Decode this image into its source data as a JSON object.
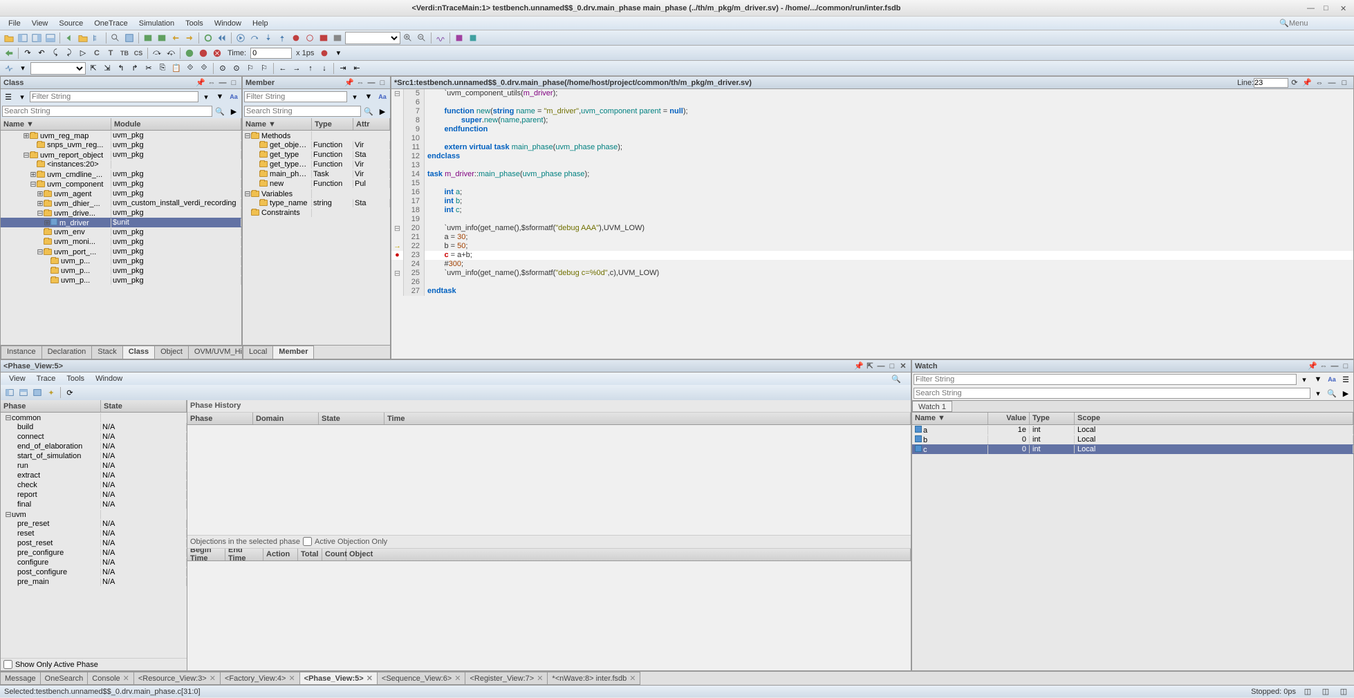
{
  "title": "<Verdi:nTraceMain:1> testbench.unnamed$$_0.drv.main_phase main_phase (../th/m_pkg/m_driver.sv) - /home/.../common/run/inter.fsdb",
  "menubar": [
    "File",
    "View",
    "Source",
    "OneTrace",
    "Simulation",
    "Tools",
    "Window",
    "Help"
  ],
  "menu_search_placeholder": "Menu",
  "toolbar2": {
    "time_label": "Time:",
    "time_value": "0",
    "time_unit": "x 1ps"
  },
  "class_pane": {
    "title": "Class",
    "filter_placeholder": "Filter String",
    "search_placeholder": "Search String",
    "headers": [
      "Name ▼",
      "Module"
    ],
    "rows": [
      {
        "indent": 3,
        "exp": "⊞",
        "icon": "folder",
        "name": "uvm_reg_map",
        "module": "uvm_pkg"
      },
      {
        "indent": 4,
        "exp": "",
        "icon": "folder",
        "name": "snps_uvm_reg...",
        "module": "uvm_pkg"
      },
      {
        "indent": 3,
        "exp": "⊟",
        "icon": "folder",
        "name": "uvm_report_object",
        "module": "uvm_pkg"
      },
      {
        "indent": 4,
        "exp": "",
        "icon": "folder",
        "name": "<instances:20>",
        "module": ""
      },
      {
        "indent": 4,
        "exp": "⊞",
        "icon": "folder",
        "name": "uvm_cmdline_...",
        "module": "uvm_pkg"
      },
      {
        "indent": 4,
        "exp": "⊟",
        "icon": "folder",
        "name": "uvm_component",
        "module": "uvm_pkg"
      },
      {
        "indent": 5,
        "exp": "⊞",
        "icon": "folder",
        "name": "uvm_agent",
        "module": "uvm_pkg"
      },
      {
        "indent": 5,
        "exp": "⊞",
        "icon": "folder",
        "name": "uvm_dhier_...",
        "module": "uvm_custom_install_verdi_recording"
      },
      {
        "indent": 5,
        "exp": "⊟",
        "icon": "folder",
        "name": "uvm_drive...",
        "module": "uvm_pkg"
      },
      {
        "indent": 6,
        "exp": "⊞",
        "icon": "class",
        "name": "m_driver",
        "module": "$unit",
        "selected": true
      },
      {
        "indent": 5,
        "exp": "",
        "icon": "folder",
        "name": "uvm_env",
        "module": "uvm_pkg"
      },
      {
        "indent": 5,
        "exp": "",
        "icon": "folder",
        "name": "uvm_moni...",
        "module": "uvm_pkg"
      },
      {
        "indent": 5,
        "exp": "⊟",
        "icon": "folder",
        "name": "uvm_port_...",
        "module": "uvm_pkg"
      },
      {
        "indent": 6,
        "exp": "",
        "icon": "folder",
        "name": "uvm_p...",
        "module": "uvm_pkg"
      },
      {
        "indent": 6,
        "exp": "",
        "icon": "folder",
        "name": "uvm_p...",
        "module": "uvm_pkg"
      },
      {
        "indent": 6,
        "exp": "",
        "icon": "folder",
        "name": "uvm_p...",
        "module": "uvm_pkg"
      }
    ],
    "tabs": [
      "Instance",
      "Declaration",
      "Stack",
      "Class",
      "Object",
      "OVM/UVM_Hier."
    ],
    "active_tab": 3
  },
  "member_pane": {
    "title": "Member",
    "filter_placeholder": "Filter String",
    "search_placeholder": "Search String",
    "headers": [
      "Name ▼",
      "Type",
      "Attr"
    ],
    "rows": [
      {
        "indent": 0,
        "exp": "⊟",
        "icon": "folder",
        "name": "Methods",
        "type": "",
        "attr": ""
      },
      {
        "indent": 1,
        "exp": "",
        "icon": "method",
        "name": "get_object_t...",
        "type": "Function",
        "attr": "Vir"
      },
      {
        "indent": 1,
        "exp": "",
        "icon": "method",
        "name": "get_type",
        "type": "Function",
        "attr": "Sta"
      },
      {
        "indent": 1,
        "exp": "",
        "icon": "method",
        "name": "get_type_na...",
        "type": "Function",
        "attr": "Vir"
      },
      {
        "indent": 1,
        "exp": "",
        "icon": "method",
        "name": "main_phase",
        "type": "Task",
        "attr": "Vir"
      },
      {
        "indent": 1,
        "exp": "",
        "icon": "method",
        "name": "new",
        "type": "Function",
        "attr": "Pul"
      },
      {
        "indent": 0,
        "exp": "⊟",
        "icon": "folder",
        "name": "Variables",
        "type": "",
        "attr": ""
      },
      {
        "indent": 1,
        "exp": "",
        "icon": "var",
        "name": "type_name",
        "type": "string",
        "attr": "Sta"
      },
      {
        "indent": 0,
        "exp": "",
        "icon": "folder",
        "name": "Constraints",
        "type": "",
        "attr": ""
      }
    ],
    "tabs": [
      "Local",
      "Member"
    ],
    "active_tab": 1
  },
  "source": {
    "title": "*Src1:testbench.unnamed$$_0.drv.main_phase(/home/host/project/common/th/m_pkg/m_driver.sv)",
    "line_label": "Line:",
    "line_value": "23",
    "lines": [
      {
        "n": 5,
        "g": "⊟",
        "code": "        `uvm_component_utils(<cls>m_driver</cls>);"
      },
      {
        "n": 6,
        "g": "",
        "code": ""
      },
      {
        "n": 7,
        "g": "",
        "code": "        <kw>function</kw> <type>new</type>(<kw>string</kw> <type>name</type> = <str>\"m_driver\"</str>,<type>uvm_component</type> <type>parent</type> = <kw>null</kw>);"
      },
      {
        "n": 8,
        "g": "",
        "code": "                <kw>super</kw>.<type>new</type>(<type>name</type>,<type>parent</type>);"
      },
      {
        "n": 9,
        "g": "",
        "code": "        <kw>endfunction</kw>"
      },
      {
        "n": 10,
        "g": "",
        "code": ""
      },
      {
        "n": 11,
        "g": "",
        "code": "        <kw>extern</kw> <kw>virtual</kw> <kw>task</kw> <type>main_phase</type>(<type>uvm_phase</type> <type>phase</type>);"
      },
      {
        "n": 12,
        "g": "",
        "code": "<kw>endclass</kw>"
      },
      {
        "n": 13,
        "g": "",
        "code": ""
      },
      {
        "n": 14,
        "g": "",
        "code": "<kw>task</kw> <cls>m_driver</cls>::<type>main_phase</type>(<type>uvm_phase</type> <type>phase</type>);"
      },
      {
        "n": 15,
        "g": "",
        "code": ""
      },
      {
        "n": 16,
        "g": "",
        "code": "        <kw>int</kw> <type>a</type>;"
      },
      {
        "n": 17,
        "g": "",
        "code": "        <kw>int</kw> <type>b</type>;"
      },
      {
        "n": 18,
        "g": "",
        "code": "        <kw>int</kw> <type>c</type>;"
      },
      {
        "n": 19,
        "g": "",
        "code": ""
      },
      {
        "n": 20,
        "g": "⊟",
        "code": "        `uvm_info(get_name(),$sformatf(<str>\"debug AAA\"</str>),UVM_LOW)"
      },
      {
        "n": 21,
        "g": "",
        "code": "        a = <num>30</num>;"
      },
      {
        "n": 22,
        "g": "→",
        "code": "        b = <num>50</num>;"
      },
      {
        "n": 23,
        "g": "●",
        "code": "        <bp>c</bp> = a+b;",
        "current": true
      },
      {
        "n": 24,
        "g": "",
        "code": "        #<num>300</num>;"
      },
      {
        "n": 25,
        "g": "⊟",
        "code": "        `uvm_info(get_name(),$sformatf(<str>\"debug c=%0d\"</str>,c),UVM_LOW)"
      },
      {
        "n": 26,
        "g": "",
        "code": ""
      },
      {
        "n": 27,
        "g": "",
        "code": "<kw>endtask</kw>"
      }
    ]
  },
  "phase_view": {
    "title": "<Phase_View:5>",
    "menubar": [
      "View",
      "Trace",
      "Tools",
      "Window"
    ],
    "phase_headers": [
      "Phase",
      "State"
    ],
    "phase_rows": [
      {
        "indent": 0,
        "exp": "⊟",
        "name": "common",
        "state": ""
      },
      {
        "indent": 1,
        "name": "build",
        "state": "N/A"
      },
      {
        "indent": 1,
        "name": "connect",
        "state": "N/A"
      },
      {
        "indent": 1,
        "name": "end_of_elaboration",
        "state": "N/A"
      },
      {
        "indent": 1,
        "name": "start_of_simulation",
        "state": "N/A"
      },
      {
        "indent": 1,
        "name": "run",
        "state": "N/A"
      },
      {
        "indent": 1,
        "name": "extract",
        "state": "N/A"
      },
      {
        "indent": 1,
        "name": "check",
        "state": "N/A"
      },
      {
        "indent": 1,
        "name": "report",
        "state": "N/A"
      },
      {
        "indent": 1,
        "name": "final",
        "state": "N/A"
      },
      {
        "indent": 0,
        "exp": "⊟",
        "name": "uvm",
        "state": ""
      },
      {
        "indent": 1,
        "name": "pre_reset",
        "state": "N/A"
      },
      {
        "indent": 1,
        "name": "reset",
        "state": "N/A"
      },
      {
        "indent": 1,
        "name": "post_reset",
        "state": "N/A"
      },
      {
        "indent": 1,
        "name": "pre_configure",
        "state": "N/A"
      },
      {
        "indent": 1,
        "name": "configure",
        "state": "N/A"
      },
      {
        "indent": 1,
        "name": "post_configure",
        "state": "N/A"
      },
      {
        "indent": 1,
        "name": "pre_main",
        "state": "N/A"
      }
    ],
    "history_title": "Phase History",
    "history_headers": [
      "Phase",
      "Domain",
      "State",
      "Time"
    ],
    "objections_label": "Objections in the selected phase",
    "objections_checkbox": "Active Objection Only",
    "objections_headers": [
      "Begin Time",
      "End Time",
      "Action",
      "Total",
      "Count",
      "Object"
    ],
    "footer_checkbox": "Show Only Active Phase"
  },
  "watch": {
    "title": "Watch",
    "filter_placeholder": "Filter String",
    "search_placeholder": "Search String",
    "tab": "Watch 1",
    "headers": [
      "Name ▼",
      "Value",
      "Type",
      "Scope"
    ],
    "rows": [
      {
        "name": "a",
        "value": "1e",
        "type": "int",
        "scope": "Local"
      },
      {
        "name": "b",
        "value": "0",
        "type": "int",
        "scope": "Local"
      },
      {
        "name": "c",
        "value": "0",
        "type": "int",
        "scope": "Local",
        "selected": true
      }
    ]
  },
  "bottom_tabs": [
    "Message",
    "OneSearch",
    "Console",
    "<Resource_View:3>",
    "<Factory_View:4>",
    "<Phase_View:5>",
    "<Sequence_View:6>",
    "<Register_View:7>",
    "*<nWave:8> inter.fsdb"
  ],
  "bottom_active_tab": 5,
  "statusbar": {
    "left": "Selected:testbench.unnamed$$_0.drv.main_phase.c[31:0]",
    "stopped": "Stopped:  0ps"
  }
}
